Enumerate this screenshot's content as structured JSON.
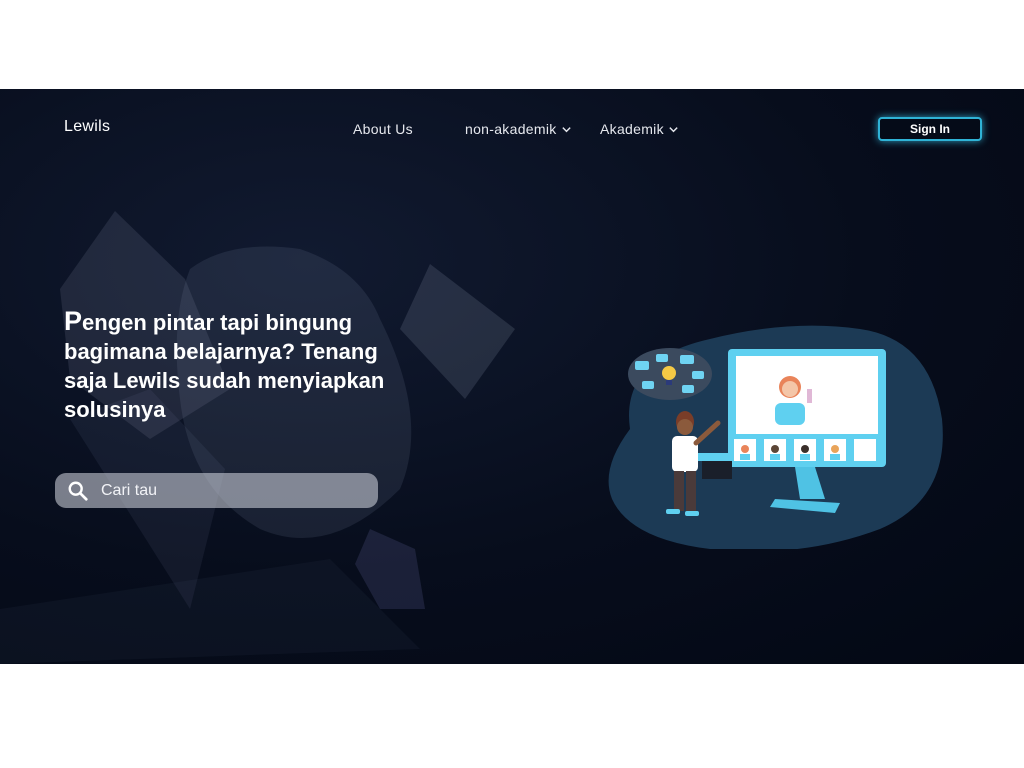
{
  "brand": {
    "name": "Lewils"
  },
  "nav": {
    "items": [
      {
        "label": "About Us",
        "has_dropdown": false
      },
      {
        "label": "non-akademik",
        "has_dropdown": true,
        "icon": "chevron-down-icon"
      },
      {
        "label": "Akademik",
        "has_dropdown": true,
        "icon": "chevron-down-icon"
      }
    ],
    "signin_label": "Sign In"
  },
  "hero": {
    "headline_first_letter": "P",
    "headline_rest": "engen pintar tapi bingung bagimana belajarnya? Tenang saja Lewils sudah menyiapkan solusinya"
  },
  "search": {
    "placeholder": "Cari tau",
    "value": "",
    "icon": "search-icon"
  },
  "illustration": {
    "icon": "online-class-illustration"
  },
  "colors": {
    "background": "#060c1a",
    "accent": "#2fb3d6",
    "text": "#ffffff",
    "blob": "#1c3a55",
    "screen": "#5fd0f0"
  }
}
